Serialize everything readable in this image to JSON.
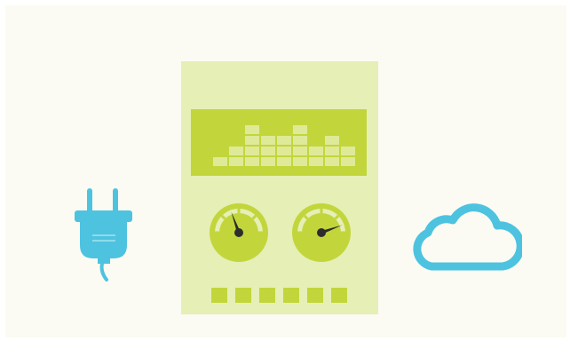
{
  "colors": {
    "background": "#fbfbf3",
    "plug": "#4dc3e0",
    "cloud": "#4dc3e0",
    "device_body": "#e6efb6",
    "device_accent": "#c2d63c",
    "equalizer_cell": "#dfea98",
    "gauge_needle": "#2d2d2d"
  },
  "icons": {
    "plug": "power-plug-icon",
    "device": "audio-device",
    "cloud": "cloud-icon"
  },
  "equalizer": {
    "bar_levels": [
      1,
      2,
      4,
      3,
      3,
      4,
      2,
      3,
      2
    ]
  },
  "gauges": [
    {
      "name": "left-gauge",
      "needle_angle_deg": -20
    },
    {
      "name": "right-gauge",
      "needle_angle_deg": 70
    }
  ],
  "button_count": 6
}
